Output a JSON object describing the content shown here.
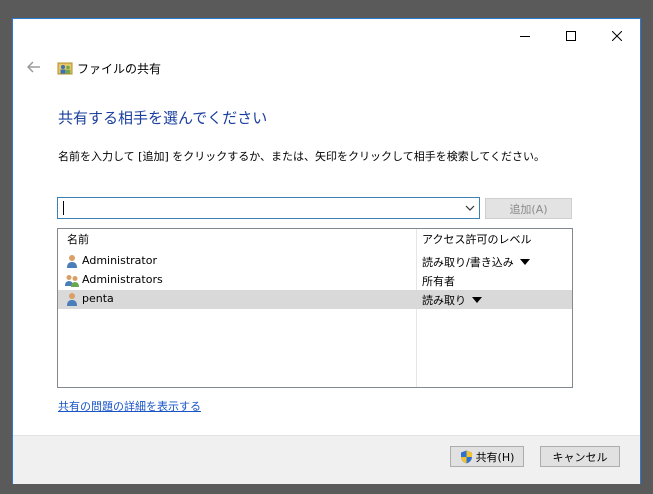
{
  "window": {
    "title": "ファイルの共有"
  },
  "main": {
    "heading": "共有する相手を選んでください",
    "instruction": "名前を入力して [追加] をクリックするか、または、矢印をクリックして相手を検索してください。",
    "input_value": "",
    "add_button_label": "追加(A)"
  },
  "list": {
    "col_name": "名前",
    "col_level": "アクセス許可のレベル",
    "rows": [
      {
        "name": "Administrator",
        "level": "読み取り/書き込み",
        "has_dropdown": true,
        "icon": "user-icon"
      },
      {
        "name": "Administrators",
        "level": "所有者",
        "has_dropdown": false,
        "icon": "group-icon"
      },
      {
        "name": "penta",
        "level": "読み取り",
        "has_dropdown": true,
        "icon": "user-icon"
      }
    ]
  },
  "link_text": "共有の問題の詳細を表示する",
  "footer": {
    "share_label": "共有(H)",
    "cancel_label": "キャンセル"
  },
  "colors": {
    "heading": "#1a3f9e",
    "link": "#1a55c7",
    "window_border": "#2b79d0",
    "selected_row": "#d9d9d9"
  }
}
